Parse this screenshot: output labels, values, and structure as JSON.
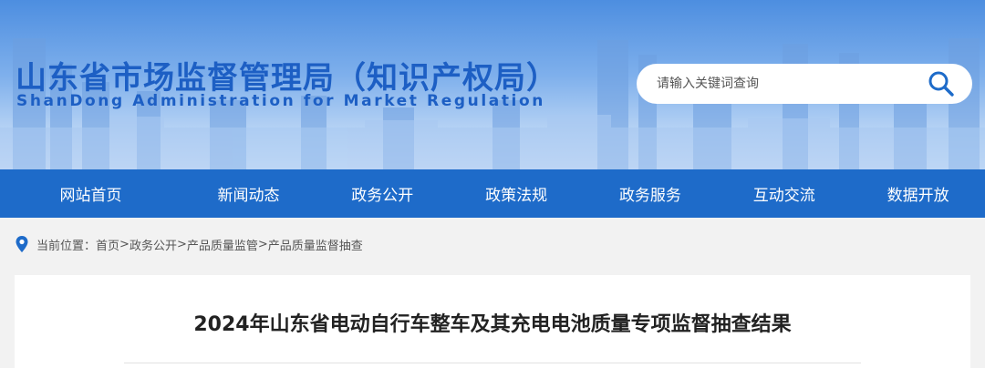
{
  "header": {
    "title": "山东省市场监督管理局（知识产权局）",
    "subtitle": "ShanDong Administration for Market Regulation",
    "search_placeholder": "请输入关键词查询",
    "search_icon": "search-icon"
  },
  "nav": {
    "items": [
      {
        "label": "网站首页"
      },
      {
        "label": "新闻动态"
      },
      {
        "label": "政务公开"
      },
      {
        "label": "政策法规"
      },
      {
        "label": "政务服务"
      },
      {
        "label": "互动交流"
      },
      {
        "label": "数据开放"
      }
    ]
  },
  "breadcrumb": {
    "prefix": "当前位置：",
    "items": [
      "首页",
      "政务公开",
      "产品质量监管",
      "产品质量监督抽查"
    ],
    "separator": ">"
  },
  "article": {
    "title": "2024年山东省电动自行车整车及其充电电池质量专项监督抽查结果"
  },
  "colors": {
    "brand_blue": "#1e6bc9",
    "title_blue": "#1d5fc4"
  }
}
